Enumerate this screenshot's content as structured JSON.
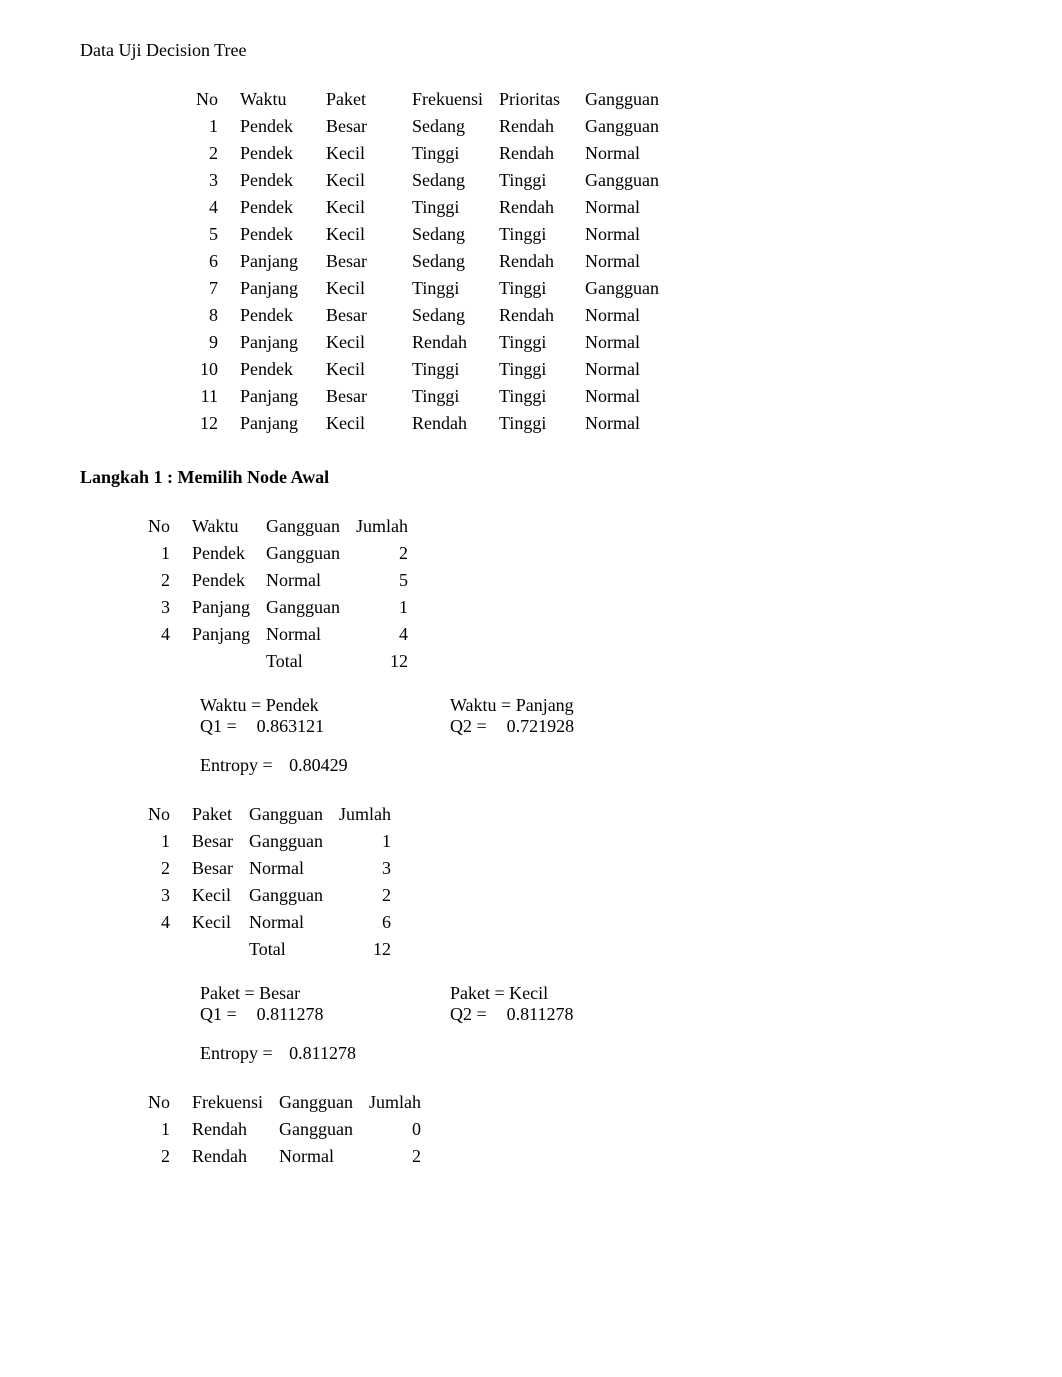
{
  "title": "Data Uji Decision Tree",
  "mainTable": {
    "headers": [
      "No",
      "Waktu",
      "Paket",
      "Frekuensi",
      "Prioritas",
      "Gangguan"
    ],
    "rows": [
      [
        "1",
        "Pendek",
        "Besar",
        "Sedang",
        "Rendah",
        "Gangguan"
      ],
      [
        "2",
        "Pendek",
        "Kecil",
        "Tinggi",
        "Rendah",
        "Normal"
      ],
      [
        "3",
        "Pendek",
        "Kecil",
        "Sedang",
        "Tinggi",
        "Gangguan"
      ],
      [
        "4",
        "Pendek",
        "Kecil",
        "Tinggi",
        "Rendah",
        "Normal"
      ],
      [
        "5",
        "Pendek",
        "Kecil",
        "Sedang",
        "Tinggi",
        "Normal"
      ],
      [
        "6",
        "Panjang",
        "Besar",
        "Sedang",
        "Rendah",
        "Normal"
      ],
      [
        "7",
        "Panjang",
        "Kecil",
        "Tinggi",
        "Tinggi",
        "Gangguan"
      ],
      [
        "8",
        "Pendek",
        "Besar",
        "Sedang",
        "Rendah",
        "Normal"
      ],
      [
        "9",
        "Panjang",
        "Kecil",
        "Rendah",
        "Tinggi",
        "Normal"
      ],
      [
        "10",
        "Pendek",
        "Kecil",
        "Tinggi",
        "Tinggi",
        "Normal"
      ],
      [
        "11",
        "Panjang",
        "Besar",
        "Tinggi",
        "Tinggi",
        "Normal"
      ],
      [
        "12",
        "Panjang",
        "Kecil",
        "Rendah",
        "Tinggi",
        "Normal"
      ]
    ]
  },
  "section1": "Langkah 1 : Memilih Node Awal",
  "waktuTable": {
    "headers": [
      "No",
      "Waktu",
      "Gangguan",
      "Jumlah"
    ],
    "rows": [
      [
        "1",
        "Pendek",
        "Gangguan",
        "2"
      ],
      [
        "2",
        "Pendek",
        "Normal",
        "5"
      ],
      [
        "3",
        "Panjang",
        "Gangguan",
        "1"
      ],
      [
        "4",
        "Panjang",
        "Normal",
        "4"
      ]
    ],
    "totalLabel": "Total",
    "totalValue": "12"
  },
  "waktuCalc": {
    "left": {
      "title": "Waktu = Pendek",
      "qlabel": "Q1 =",
      "qval": "0.863121"
    },
    "right": {
      "title": "Waktu = Panjang",
      "qlabel": "Q2 =",
      "qval": "0.721928"
    },
    "entropyLabel": "Entropy =",
    "entropyValue": "0.80429"
  },
  "paketTable": {
    "headers": [
      "No",
      "Paket",
      "Gangguan",
      "Jumlah"
    ],
    "rows": [
      [
        "1",
        "Besar",
        "Gangguan",
        "1"
      ],
      [
        "2",
        "Besar",
        "Normal",
        "3"
      ],
      [
        "3",
        "Kecil",
        "Gangguan",
        "2"
      ],
      [
        "4",
        "Kecil",
        "Normal",
        "6"
      ]
    ],
    "totalLabel": "Total",
    "totalValue": "12"
  },
  "paketCalc": {
    "left": {
      "title": "Paket = Besar",
      "qlabel": "Q1 =",
      "qval": "0.811278"
    },
    "right": {
      "title": "Paket = Kecil",
      "qlabel": "Q2 =",
      "qval": "0.811278"
    },
    "entropyLabel": "Entropy =",
    "entropyValue": "0.811278"
  },
  "frekTable": {
    "headers": [
      "No",
      "Frekuensi",
      "Gangguan",
      "Jumlah"
    ],
    "rows": [
      [
        "1",
        "Rendah",
        "Gangguan",
        "0"
      ],
      [
        "2",
        "Rendah",
        "Normal",
        "2"
      ]
    ]
  }
}
